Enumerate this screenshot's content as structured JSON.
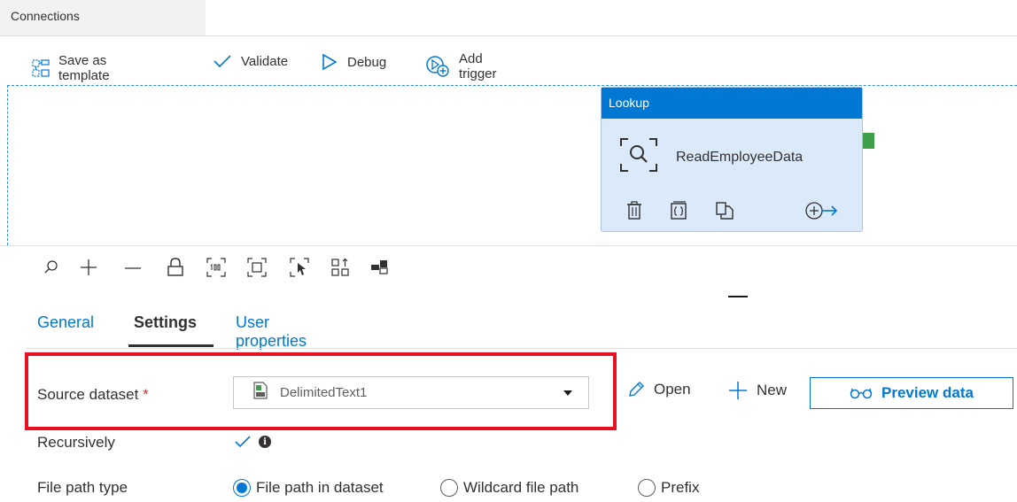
{
  "window": {
    "tab_label": "Connections"
  },
  "toolbar": {
    "save_template_label": "Save as template",
    "validate_label": "Validate",
    "debug_label": "Debug",
    "add_trigger_label": "Add trigger"
  },
  "activity": {
    "type_label": "Lookup",
    "name": "ReadEmployeeData"
  },
  "tabs": [
    {
      "label": "General",
      "active": false
    },
    {
      "label": "Settings",
      "active": true
    },
    {
      "label": "User properties",
      "active": false
    }
  ],
  "settings": {
    "source_dataset_label": "Source dataset",
    "required_marker": "*",
    "source_dataset_value": "DelimitedText1",
    "open_label": "Open",
    "new_label": "New",
    "preview_label": "Preview data",
    "recursively_label": "Recursively",
    "recursively_checked": true,
    "info_glyph": "i",
    "file_path_type_label": "File path type",
    "file_path_options": [
      {
        "label": "File path in dataset",
        "selected": true
      },
      {
        "label": "Wildcard file path",
        "selected": false
      },
      {
        "label": "Prefix",
        "selected": false
      }
    ]
  },
  "colors": {
    "accent": "#0078d4",
    "node_fill": "#dbeafa",
    "highlight": "#e81123",
    "port": "#3e9e4a"
  }
}
